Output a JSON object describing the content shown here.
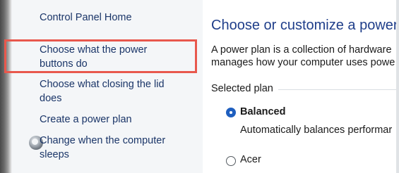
{
  "sidebar": {
    "home_link": "Control Panel Home",
    "power_buttons_link_line1": "Choose what the power",
    "power_buttons_link_line2": "buttons do",
    "lid_link_line1": "Choose what closing the lid",
    "lid_link_line2": "does",
    "create_plan_link": "Create a power plan",
    "sleep_link_line1": "Change when the computer",
    "sleep_link_line2": "sleeps",
    "sleep_link_icon": "shield-icon",
    "highlight_color": "#e8584d"
  },
  "main": {
    "title": "Choose or customize a power p",
    "description_line1": "A power plan is a collection of hardware",
    "description_line2": "manages how your computer uses powe",
    "selected_plan_label": "Selected plan",
    "plans": [
      {
        "name": "Balanced",
        "selected": true,
        "description": "Automatically balances performar"
      },
      {
        "name": "Acer",
        "selected": false
      }
    ],
    "title_color": "#1f3e8a",
    "link_color": "#1a3568",
    "radio_color": "#1f5fbf"
  }
}
